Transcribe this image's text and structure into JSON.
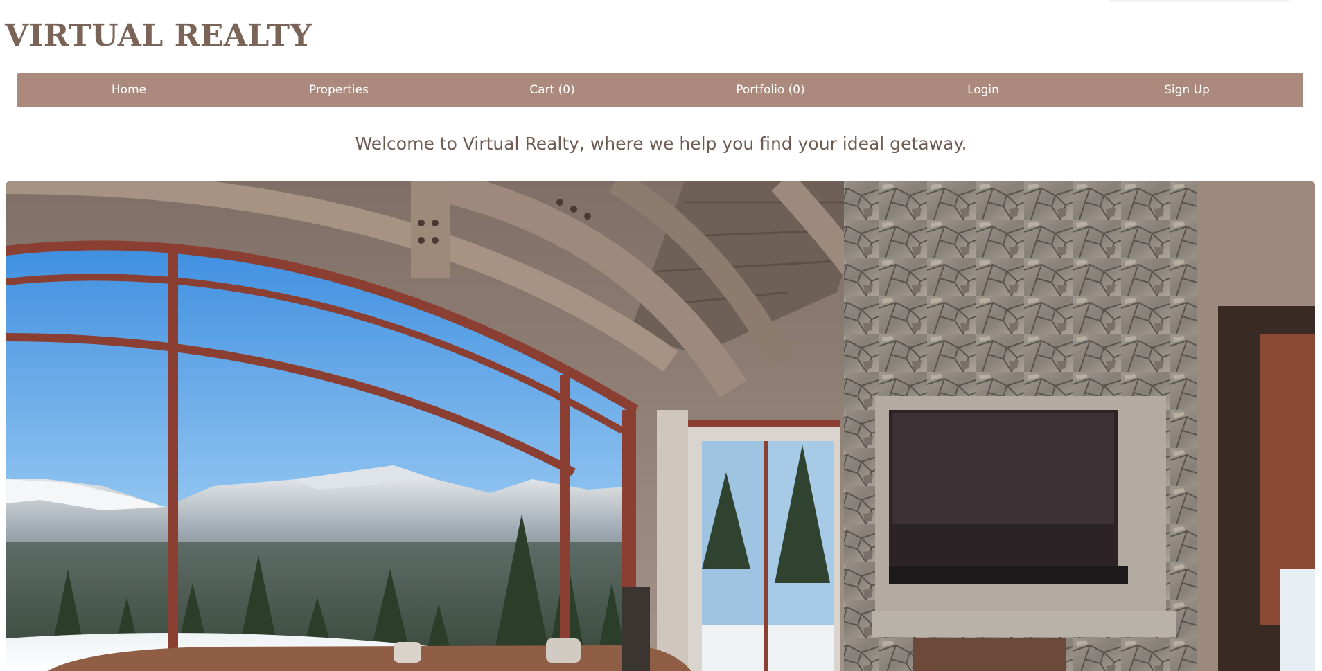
{
  "site": {
    "logo_text": "VIRTUAL REALTY"
  },
  "nav": {
    "items": [
      {
        "label": "Home"
      },
      {
        "label": "Properties"
      },
      {
        "label": "Cart (0)"
      },
      {
        "label": "Portfolio (0)"
      },
      {
        "label": "Login"
      },
      {
        "label": "Sign Up"
      }
    ]
  },
  "welcome": {
    "text": "Welcome to Virtual Realty, where we help you find your ideal getaway."
  },
  "hero": {
    "icon": "mountain-lodge-living-room-image"
  },
  "colors": {
    "nav_background": "#ab8a7d",
    "logo": "#7a6458",
    "welcome_text": "#6e5b52",
    "nav_text": "#ffffff"
  }
}
